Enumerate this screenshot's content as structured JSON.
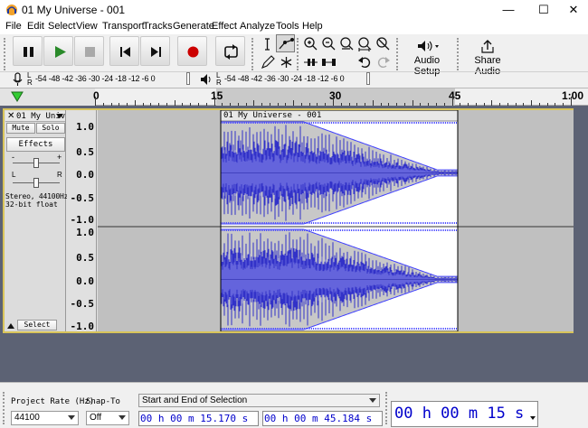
{
  "window": {
    "title": "01 My Universe - 001",
    "minimize": "—",
    "maximize": "☐",
    "close": "✕"
  },
  "menu": [
    "File",
    "Edit",
    "Select",
    "View",
    "Transport",
    "Tracks",
    "Generate",
    "Effect",
    "Analyze",
    "Tools",
    "Help"
  ],
  "toolbar": {
    "audio_setup_label": "Audio Setup",
    "share_audio_label": "Share Audio"
  },
  "meters": {
    "record_scale": "-54 -48 -42 -36 -30 -24 -18 -12 -6 0",
    "play_scale": "-54 -48 -42 -36 -30 -24 -18 -12 -6 0",
    "record_l": "L",
    "record_r": "R",
    "play_l": "L",
    "play_r": "R"
  },
  "timeline": {
    "ticks": [
      "0",
      "15",
      "30",
      "45",
      "1:00"
    ]
  },
  "track": {
    "name": "01 My Univ",
    "clip_name": "01 My Universe - 001",
    "mute_label": "Mute",
    "solo_label": "Solo",
    "effects_label": "Effects",
    "gain_minus": "-",
    "gain_plus": "+",
    "pan_l": "L",
    "pan_r": "R",
    "info_rate": "Stereo, 44100Hz",
    "info_format": "32-bit float",
    "select_label": "Select",
    "ruler_top": [
      "1.0",
      "0.5",
      "0.0",
      "-0.5",
      "-1.0"
    ],
    "ruler_bottom": [
      "1.0",
      "0.5",
      "0.0",
      "-0.5",
      "-1.0"
    ]
  },
  "selection_bar": {
    "project_rate_label": "Project Rate (Hz)",
    "project_rate_value": "44100",
    "snap_to_label": "Snap-To",
    "snap_to_value": "Off",
    "selection_mode": "Start and End of Selection",
    "start_time": "00 h 00 m 15.170 s",
    "end_time": "00 h 00 m 45.184 s",
    "audio_position": "00 h 00 m 15 s"
  },
  "colors": {
    "waveform": "#3232c8",
    "waveform_rms": "#6464dc",
    "clip_selected_bg": "#ffffff",
    "track_bg": "#c0c0c0",
    "focus_border": "#d8c45a",
    "record_button": "#cc0000",
    "play_button": "#2a8a2a"
  }
}
